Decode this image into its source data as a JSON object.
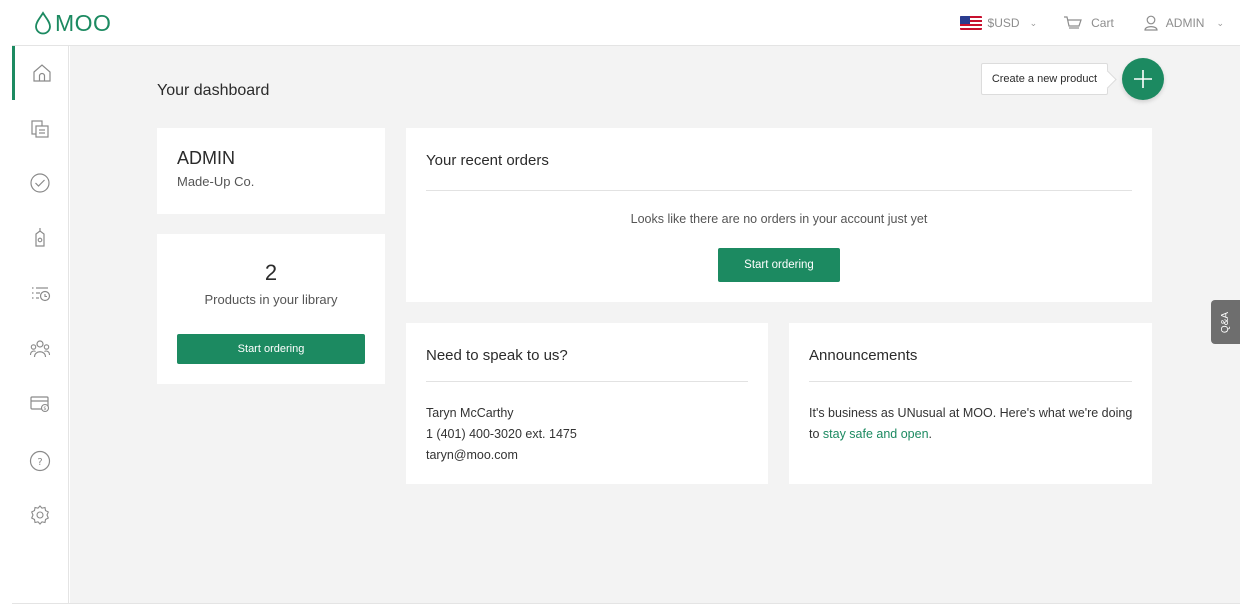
{
  "brand": {
    "logo_text": "MOO",
    "accent_color": "#1c8a61"
  },
  "topbar": {
    "currency_label": "$USD",
    "cart_label": "Cart",
    "account_label": "ADMIN",
    "flag_icon": "us-flag-icon",
    "cart_icon": "cart-icon",
    "account_icon": "user-icon"
  },
  "sidebar": {
    "items": [
      {
        "name": "home",
        "icon": "home-icon",
        "active": true
      },
      {
        "name": "templates",
        "icon": "documents-icon"
      },
      {
        "name": "approvals",
        "icon": "check-circle-icon"
      },
      {
        "name": "products",
        "icon": "tag-icon"
      },
      {
        "name": "orders",
        "icon": "list-clock-icon"
      },
      {
        "name": "team",
        "icon": "users-icon"
      },
      {
        "name": "billing",
        "icon": "credit-card-icon"
      },
      {
        "name": "help",
        "icon": "question-icon"
      },
      {
        "name": "settings",
        "icon": "gear-icon"
      }
    ]
  },
  "main": {
    "title": "Your dashboard",
    "create_tooltip": "Create a new product",
    "account": {
      "name": "ADMIN",
      "company": "Made-Up Co."
    },
    "library": {
      "count": "2",
      "label": "Products in your library",
      "button": "Start ordering"
    },
    "orders": {
      "heading": "Your recent orders",
      "empty_message": "Looks like there are no orders in your account just yet",
      "button": "Start ordering"
    },
    "contact": {
      "heading": "Need to speak to us?",
      "name": "Taryn McCarthy",
      "phone": "1 (401) 400-3020 ext. 1475",
      "email": "taryn@moo.com"
    },
    "announcements": {
      "heading": "Announcements",
      "text_before": "It's business as UNusual at MOO. Here's what we're doing to ",
      "link_text": "stay safe and open",
      "text_after": "."
    }
  },
  "qa_tab": {
    "label": "Q&A"
  }
}
